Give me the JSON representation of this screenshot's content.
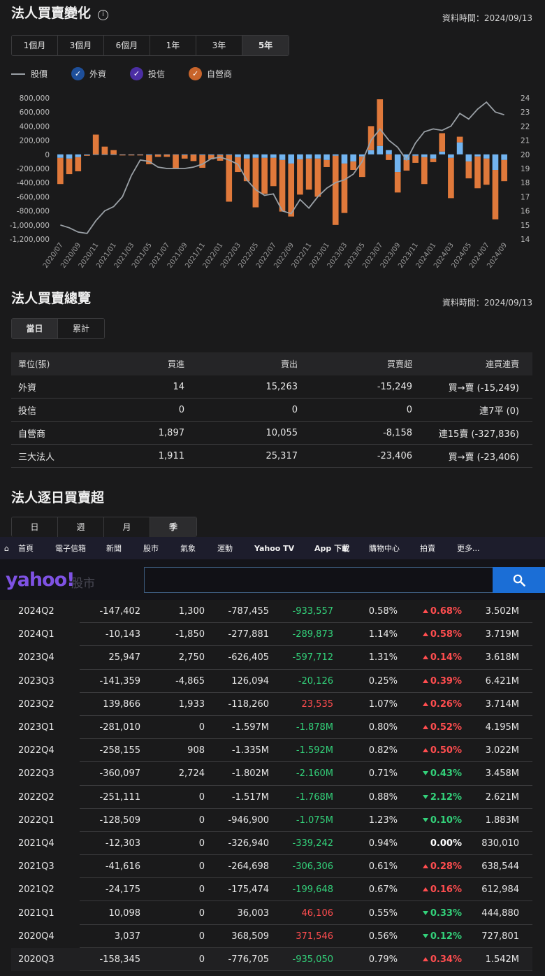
{
  "section1": {
    "title": "法人買賣變化",
    "asof": "資料時間：2024/09/13"
  },
  "periods": [
    {
      "label": "1個月",
      "active": false
    },
    {
      "label": "3個月",
      "active": false
    },
    {
      "label": "6個月",
      "active": false
    },
    {
      "label": "1年",
      "active": false
    },
    {
      "label": "3年",
      "active": false
    },
    {
      "label": "5年",
      "active": true
    }
  ],
  "legend": {
    "price": "股價",
    "foreign": "外資",
    "trust": "投信",
    "dealer": "自營商"
  },
  "colors": {
    "foreign": "#72b4f0",
    "trust": "#5c3fc4",
    "dealer": "#e0793b",
    "price": "#9aa0a6",
    "foreign_chk": "#1e4f9a",
    "trust_chk": "#4b2ea3",
    "dealer_chk": "#c8642b",
    "up": "#ff4d4f",
    "down": "#33d17a"
  },
  "chart_data": {
    "type": "bar",
    "x": [
      "2020/07",
      "2020/08",
      "2020/09",
      "2020/10",
      "2020/11",
      "2020/12",
      "2021/01",
      "2021/02",
      "2021/03",
      "2021/04",
      "2021/05",
      "2021/06",
      "2021/07",
      "2021/08",
      "2021/09",
      "2021/10",
      "2021/11",
      "2021/12",
      "2022/01",
      "2022/02",
      "2022/03",
      "2022/04",
      "2022/05",
      "2022/06",
      "2022/07",
      "2022/08",
      "2022/09",
      "2022/10",
      "2022/11",
      "2022/12",
      "2023/01",
      "2023/02",
      "2023/03",
      "2023/04",
      "2023/05",
      "2023/06",
      "2023/07",
      "2023/08",
      "2023/09",
      "2023/10",
      "2023/11",
      "2023/12",
      "2024/01",
      "2024/02",
      "2024/03",
      "2024/04",
      "2024/05",
      "2024/06",
      "2024/07",
      "2024/08",
      "2024/09"
    ],
    "xtick_labels": [
      "2020/07",
      "2020/09",
      "2020/11",
      "2021/01",
      "2021/03",
      "2021/05",
      "2021/07",
      "2021/09",
      "2021/11",
      "2022/01",
      "2022/03",
      "2022/05",
      "2022/07",
      "2022/09",
      "2022/11",
      "2023/01",
      "2023/03",
      "2023/05",
      "2023/07",
      "2023/09",
      "2023/11",
      "2024/01",
      "2024/03",
      "2024/05",
      "2024/07",
      "2024/09"
    ],
    "series": [
      {
        "name": "外資",
        "type": "bar",
        "values": [
          -50000,
          -60000,
          -40000,
          -10000,
          -5000,
          -5000,
          -5000,
          -5000,
          -5000,
          -5000,
          -10000,
          -5000,
          -5000,
          -5000,
          -10000,
          -5000,
          -10000,
          -10000,
          -10000,
          -10000,
          -40000,
          -60000,
          -50000,
          -50000,
          -50000,
          -80000,
          -130000,
          -70000,
          -60000,
          -60000,
          -80000,
          -20000,
          -130000,
          -100000,
          -30000,
          60000,
          120000,
          60000,
          -250000,
          -80000,
          -20000,
          -40000,
          -60000,
          40000,
          -50000,
          170000,
          -100000,
          -30000,
          -60000,
          -220000,
          -80000
        ]
      },
      {
        "name": "投信",
        "type": "bar",
        "values": [
          0,
          0,
          0,
          0,
          0,
          0,
          0,
          0,
          0,
          0,
          0,
          0,
          0,
          0,
          0,
          0,
          0,
          0,
          0,
          0,
          0,
          0,
          0,
          0,
          0,
          0,
          0,
          0,
          0,
          0,
          0,
          0,
          0,
          0,
          0,
          0,
          0,
          0,
          0,
          0,
          0,
          0,
          0,
          0,
          0,
          0,
          0,
          0,
          0,
          0,
          0
        ]
      },
      {
        "name": "自營商",
        "type": "bar",
        "values": [
          -370000,
          -220000,
          -200000,
          -10000,
          280000,
          110000,
          60000,
          -10000,
          -10000,
          -10000,
          -130000,
          -30000,
          -30000,
          -200000,
          -50000,
          -90000,
          -180000,
          -60000,
          -80000,
          -660000,
          -210000,
          -320000,
          -700000,
          -510000,
          -400000,
          -730000,
          -750000,
          -500000,
          -440000,
          -540000,
          -100000,
          -980000,
          -700000,
          -120000,
          -290000,
          340000,
          660000,
          -80000,
          -290000,
          -150000,
          -100000,
          -380000,
          -50000,
          260000,
          -570000,
          80000,
          -240000,
          -450000,
          -370000,
          -700000,
          -300000
        ]
      },
      {
        "name": "股價",
        "type": "line",
        "axis": "right",
        "values": [
          15,
          14.8,
          14.5,
          14.4,
          15.3,
          16,
          16.3,
          17,
          18.5,
          19.6,
          19.5,
          19.1,
          19,
          19,
          19,
          19.1,
          19.3,
          19.7,
          19.8,
          19.6,
          19.3,
          18.2,
          17.5,
          17.1,
          17.2,
          16,
          15.8,
          16.8,
          16.2,
          17,
          17.6,
          18,
          18.2,
          18.6,
          19.5,
          21,
          21.8,
          21,
          20.5,
          19.6,
          20.8,
          21.6,
          21.8,
          21.7,
          22,
          22.9,
          22.5,
          23.2,
          23.7,
          23,
          22.8
        ]
      }
    ],
    "ylim_left": [
      -1200000,
      800000
    ],
    "yticks_left": [
      "800,000",
      "600,000",
      "400,000",
      "200,000",
      "0",
      "-200,000",
      "-400,000",
      "-600,000",
      "-800,000",
      "-1,000,000",
      "-1,200,000"
    ],
    "ylim_right": [
      14,
      24
    ],
    "yticks_right": [
      "24",
      "23",
      "22",
      "21",
      "20",
      "19",
      "18",
      "17",
      "16",
      "15",
      "14"
    ]
  },
  "section2": {
    "title": "法人買賣總覽",
    "asof": "資料時間：2024/09/13"
  },
  "tabs2": [
    {
      "label": "當日",
      "active": true
    },
    {
      "label": "累計",
      "active": false
    }
  ],
  "overview": {
    "headers": [
      "單位(張)",
      "買進",
      "賣出",
      "買賣超",
      "連買連賣"
    ],
    "rows": [
      [
        "外資",
        "14",
        "15,263",
        "-15,249",
        "買→賣 (-15,249)"
      ],
      [
        "投信",
        "0",
        "0",
        "0",
        "連7平 (0)"
      ],
      [
        "自營商",
        "1,897",
        "10,055",
        "-8,158",
        "連15賣 (-327,836)"
      ],
      [
        "三大法人",
        "1,911",
        "25,317",
        "-23,406",
        "買→賣 (-23,406)"
      ]
    ]
  },
  "section3": {
    "title": "法人逐日買賣超"
  },
  "tabs3": [
    {
      "label": "日",
      "active": false
    },
    {
      "label": "週",
      "active": false
    },
    {
      "label": "月",
      "active": false
    },
    {
      "label": "季",
      "active": true
    }
  ],
  "nav": [
    "首頁",
    "電子信箱",
    "新聞",
    "股市",
    "氣象",
    "運動",
    "Yahoo TV",
    "App 下載",
    "購物中心",
    "拍賣",
    "更多..."
  ],
  "search": {
    "logo": "yahoo!",
    "logo_sub": "股市",
    "placeholder": ""
  },
  "quarterly": [
    {
      "q": "2024Q2",
      "f": "-147,402",
      "t": "1,300",
      "d": "-787,455",
      "tot": "-933,557",
      "totdir": "dn",
      "pct": "0.58%",
      "chg": "0.68%",
      "dir": "up",
      "vol": "3.502M"
    },
    {
      "q": "2024Q1",
      "f": "-10,143",
      "t": "-1,850",
      "d": "-277,881",
      "tot": "-289,873",
      "totdir": "dn",
      "pct": "1.14%",
      "chg": "0.58%",
      "dir": "up",
      "vol": "3.719M"
    },
    {
      "q": "2023Q4",
      "f": "25,947",
      "t": "2,750",
      "d": "-626,405",
      "tot": "-597,712",
      "totdir": "dn",
      "pct": "1.31%",
      "chg": "0.14%",
      "dir": "up",
      "vol": "3.618M"
    },
    {
      "q": "2023Q3",
      "f": "-141,359",
      "t": "-4,865",
      "d": "126,094",
      "tot": "-20,126",
      "totdir": "dn",
      "pct": "0.25%",
      "chg": "0.39%",
      "dir": "up",
      "vol": "6.421M"
    },
    {
      "q": "2023Q2",
      "f": "139,866",
      "t": "1,933",
      "d": "-118,260",
      "tot": "23,535",
      "totdir": "up",
      "pct": "1.07%",
      "chg": "0.26%",
      "dir": "up",
      "vol": "3.714M"
    },
    {
      "q": "2023Q1",
      "f": "-281,010",
      "t": "0",
      "d": "-1.597M",
      "tot": "-1.878M",
      "totdir": "dn",
      "pct": "0.80%",
      "chg": "0.52%",
      "dir": "up",
      "vol": "4.195M"
    },
    {
      "q": "2022Q4",
      "f": "-258,155",
      "t": "908",
      "d": "-1.335M",
      "tot": "-1.592M",
      "totdir": "dn",
      "pct": "0.82%",
      "chg": "0.50%",
      "dir": "up",
      "vol": "3.022M"
    },
    {
      "q": "2022Q3",
      "f": "-360,097",
      "t": "2,724",
      "d": "-1.802M",
      "tot": "-2.160M",
      "totdir": "dn",
      "pct": "0.71%",
      "chg": "0.43%",
      "dir": "dn",
      "vol": "3.458M"
    },
    {
      "q": "2022Q2",
      "f": "-251,111",
      "t": "0",
      "d": "-1.517M",
      "tot": "-1.768M",
      "totdir": "dn",
      "pct": "0.88%",
      "chg": "2.12%",
      "dir": "dn",
      "vol": "2.621M"
    },
    {
      "q": "2022Q1",
      "f": "-128,509",
      "t": "0",
      "d": "-946,900",
      "tot": "-1.075M",
      "totdir": "dn",
      "pct": "1.23%",
      "chg": "0.10%",
      "dir": "dn",
      "vol": "1.883M"
    },
    {
      "q": "2021Q4",
      "f": "-12,303",
      "t": "0",
      "d": "-326,940",
      "tot": "-339,242",
      "totdir": "dn",
      "pct": "0.94%",
      "chg": "0.00%",
      "dir": "flat",
      "vol": "830,010"
    },
    {
      "q": "2021Q3",
      "f": "-41,616",
      "t": "0",
      "d": "-264,698",
      "tot": "-306,306",
      "totdir": "dn",
      "pct": "0.61%",
      "chg": "0.28%",
      "dir": "up",
      "vol": "638,544"
    },
    {
      "q": "2021Q2",
      "f": "-24,175",
      "t": "0",
      "d": "-175,474",
      "tot": "-199,648",
      "totdir": "dn",
      "pct": "0.67%",
      "chg": "0.16%",
      "dir": "up",
      "vol": "612,984"
    },
    {
      "q": "2021Q1",
      "f": "10,098",
      "t": "0",
      "d": "36,003",
      "tot": "46,106",
      "totdir": "up",
      "pct": "0.55%",
      "chg": "0.33%",
      "dir": "dn",
      "vol": "444,880"
    },
    {
      "q": "2020Q4",
      "f": "3,037",
      "t": "0",
      "d": "368,509",
      "tot": "371,546",
      "totdir": "up",
      "pct": "0.56%",
      "chg": "0.12%",
      "dir": "dn",
      "vol": "727,801"
    },
    {
      "q": "2020Q3",
      "f": "-158,345",
      "t": "0",
      "d": "-776,705",
      "tot": "-935,050",
      "totdir": "dn",
      "pct": "0.79%",
      "chg": "0.34%",
      "dir": "up",
      "vol": "1.542M"
    }
  ]
}
